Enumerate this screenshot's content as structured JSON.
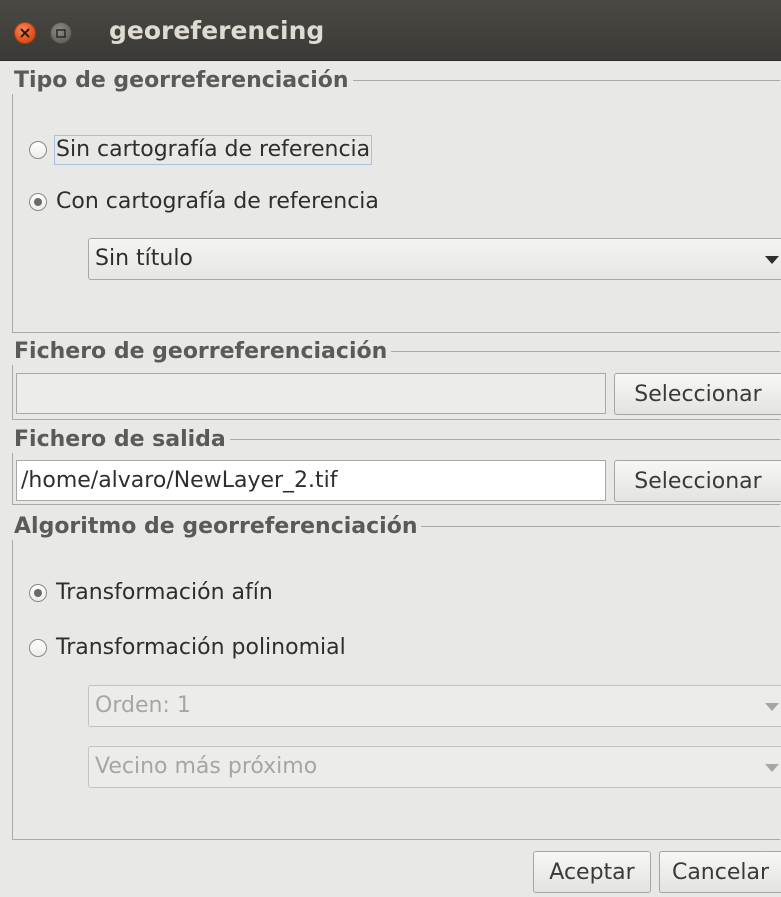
{
  "window": {
    "title": "georeferencing"
  },
  "tipo": {
    "title": "Tipo de georreferenciación",
    "option_sin": "Sin cartografía de referencia",
    "option_con": "Con cartografía de referencia",
    "selected": "Con cartografía de referencia",
    "cartography_combo": "Sin título"
  },
  "fichero_georef": {
    "title": "Fichero de georreferenciación",
    "value": "",
    "select_button": "Seleccionar"
  },
  "fichero_salida": {
    "title": "Fichero de salida",
    "value": "/home/alvaro/NewLayer_2.tif",
    "select_button": "Seleccionar"
  },
  "algoritmo": {
    "title": "Algoritmo de georreferenciación",
    "option_afin": "Transformación afín",
    "option_polinomial": "Transformación polinomial",
    "selected": "Transformación afín",
    "orden_combo": "Orden: 1",
    "interpolation_combo": "Vecino más próximo"
  },
  "footer": {
    "accept_button": "Aceptar",
    "cancel_button": "Cancelar"
  },
  "icons": {
    "close": "close-icon",
    "maximize": "maximize-icon",
    "dropdown": "chevron-down-icon"
  }
}
